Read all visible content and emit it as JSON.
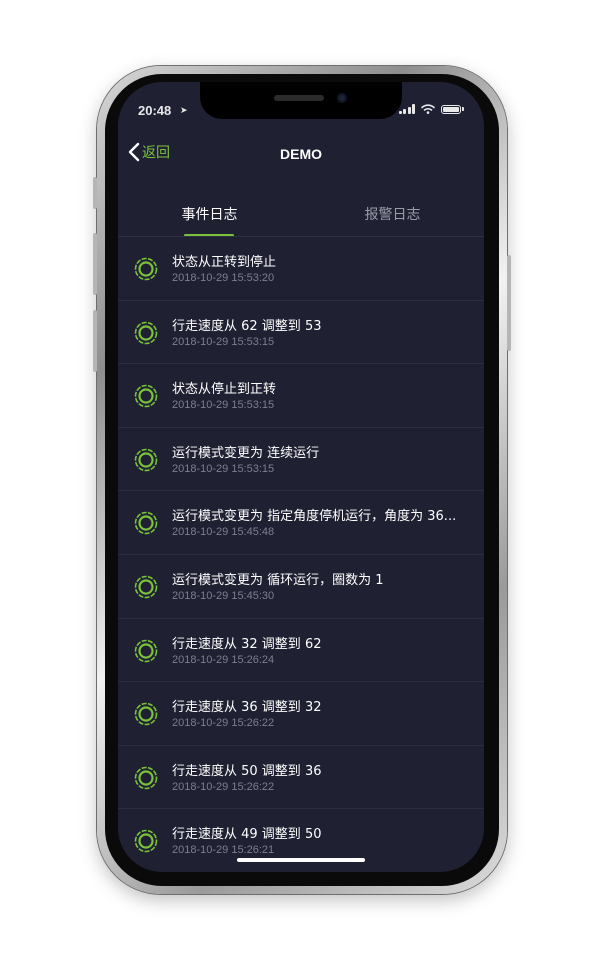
{
  "status_bar": {
    "time": "20:48",
    "location_icon": "location-arrow-icon"
  },
  "nav": {
    "back_label": "返回",
    "title": "DEMO"
  },
  "tabs": [
    {
      "label": "事件日志",
      "active": true
    },
    {
      "label": "报警日志",
      "active": false
    }
  ],
  "colors": {
    "accent": "#79c23a",
    "background": "#1f2133",
    "text_secondary": "#7c7f8f"
  },
  "events": [
    {
      "icon": "status-ring-icon",
      "title": "状态从正转到停止",
      "time": "2018-10-29 15:53:20"
    },
    {
      "icon": "status-ring-icon",
      "title": "行走速度从 62 调整到 53",
      "time": "2018-10-29 15:53:15"
    },
    {
      "icon": "status-ring-icon",
      "title": "状态从停止到正转",
      "time": "2018-10-29 15:53:15"
    },
    {
      "icon": "status-ring-icon",
      "title": "运行模式变更为 连续运行",
      "time": "2018-10-29 15:53:15"
    },
    {
      "icon": "status-ring-icon",
      "title": "运行模式变更为 指定角度停机运行，角度为 36...",
      "time": "2018-10-29 15:45:48"
    },
    {
      "icon": "status-ring-icon",
      "title": "运行模式变更为 循环运行，圈数为 1",
      "time": "2018-10-29 15:45:30"
    },
    {
      "icon": "status-ring-icon",
      "title": "行走速度从 32 调整到 62",
      "time": "2018-10-29 15:26:24"
    },
    {
      "icon": "status-ring-icon",
      "title": "行走速度从 36 调整到 32",
      "time": "2018-10-29 15:26:22"
    },
    {
      "icon": "status-ring-icon",
      "title": "行走速度从 50 调整到 36",
      "time": "2018-10-29 15:26:22"
    },
    {
      "icon": "status-ring-icon",
      "title": "行走速度从 49 调整到 50",
      "time": "2018-10-29 15:26:21"
    }
  ]
}
